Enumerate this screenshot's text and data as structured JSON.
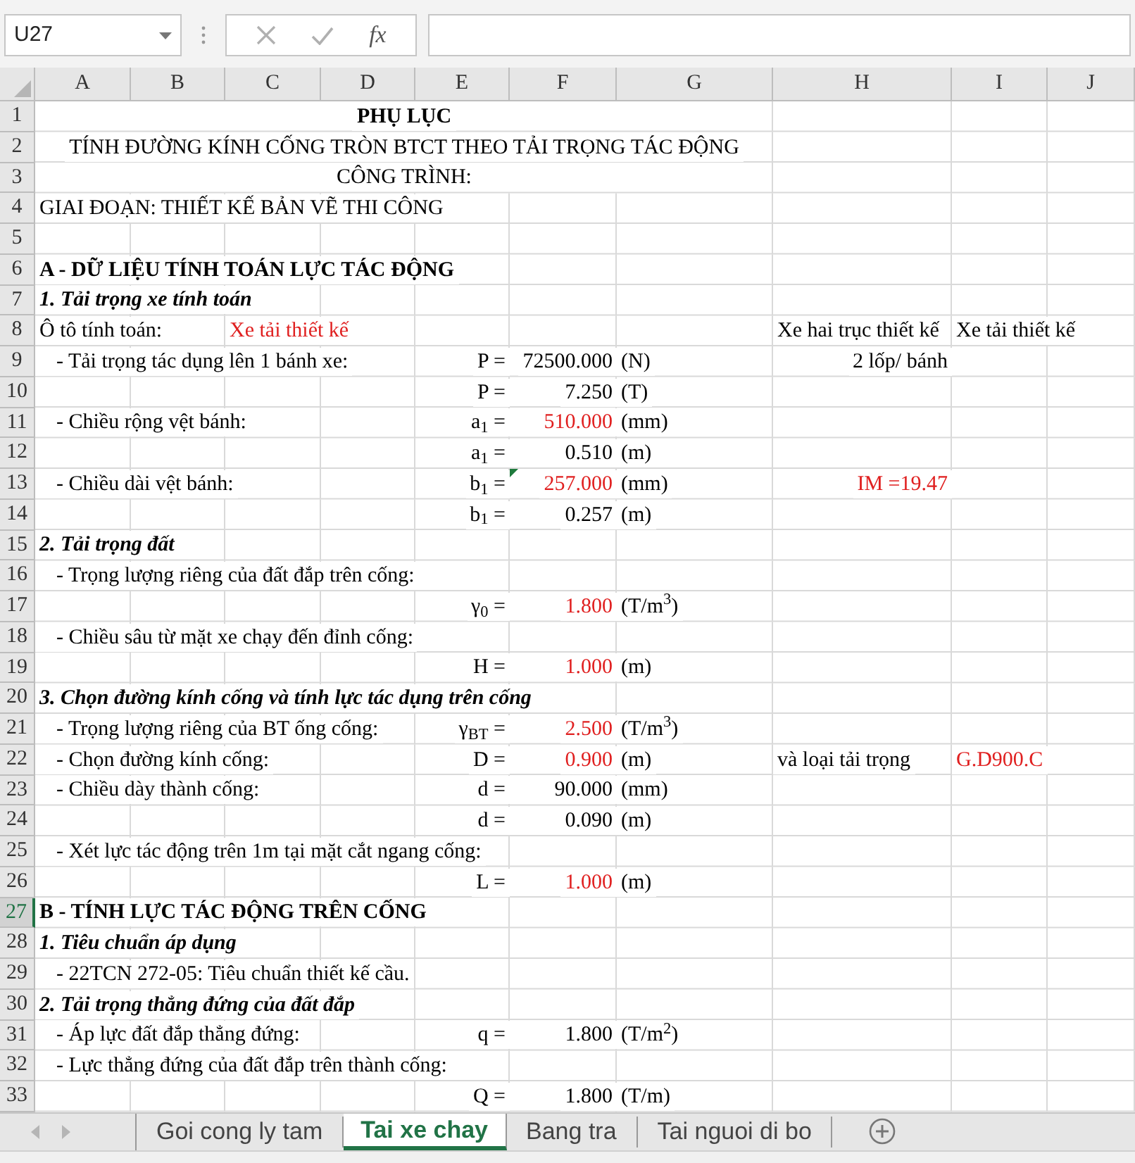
{
  "formula_bar": {
    "name_box": "U27",
    "function_label": "fx"
  },
  "columns": [
    "A",
    "B",
    "C",
    "D",
    "E",
    "F",
    "G",
    "H",
    "I",
    "J"
  ],
  "rows": [
    {
      "number": "1",
      "selected": false,
      "A": {
        "text": "PHỤ LỤC",
        "kind": "title"
      }
    },
    {
      "number": "2",
      "selected": false,
      "A": {
        "text": "TÍNH ĐƯỜNG KÍNH CỐNG TRÒN BTCT THEO TẢI TRỌNG TÁC ĐỘNG",
        "kind": "caption"
      }
    },
    {
      "number": "3",
      "selected": false,
      "A": {
        "text": "CÔNG TRÌNH:",
        "kind": "caption"
      }
    },
    {
      "number": "4",
      "selected": false,
      "A": {
        "text": "GIAI ĐOẠN: THIẾT KẾ BẢN VẼ THI CÔNG"
      }
    },
    {
      "number": "5",
      "selected": false
    },
    {
      "number": "6",
      "selected": false,
      "A": {
        "text": "A - DỮ LIỆU TÍNH TOÁN LỰC TÁC ĐỘNG",
        "kind": "heading"
      }
    },
    {
      "number": "7",
      "selected": false,
      "A": {
        "text": "1. Tải trọng xe tính toán",
        "kind": "subheading"
      }
    },
    {
      "number": "8",
      "selected": false,
      "A": {
        "text": "Ô tô tính toán:"
      },
      "C": {
        "text": "Xe tải thiết kế",
        "color": "#e02020"
      },
      "H": {
        "text": "Xe hai trục thiết kế"
      },
      "I": {
        "text": "Xe tải thiết kế"
      }
    },
    {
      "number": "9",
      "selected": false,
      "A": {
        "text": "- Tải trọng tác dụng lên 1 bánh xe:",
        "kind": "item"
      },
      "E": {
        "text": "P =",
        "kind": "right"
      },
      "F": {
        "text": "72500.000",
        "kind": "right"
      },
      "G": {
        "text": "(N)"
      },
      "H": {
        "text": "2 lốp/ bánh",
        "kind": "right"
      }
    },
    {
      "number": "10",
      "selected": false,
      "E": {
        "text": "P =",
        "kind": "right"
      },
      "F": {
        "text": "7.250",
        "kind": "right"
      },
      "G": {
        "text": "(T)"
      }
    },
    {
      "number": "11",
      "selected": false,
      "A": {
        "text": "- Chiều rộng vệt bánh:",
        "kind": "item"
      },
      "E": {
        "text": "a$_{1}$ =",
        "kind": "right"
      },
      "F": {
        "text": "510.000",
        "kind": "right",
        "color": "#e02020"
      },
      "G": {
        "text": "(mm)"
      }
    },
    {
      "number": "12",
      "selected": false,
      "E": {
        "text": "a$_{1}$ =",
        "kind": "right"
      },
      "F": {
        "text": "0.510",
        "kind": "right"
      },
      "G": {
        "text": "(m)"
      }
    },
    {
      "number": "13",
      "selected": false,
      "A": {
        "text": "- Chiều dài vệt bánh:",
        "kind": "item"
      },
      "E": {
        "text": "b$_{1}$ =",
        "kind": "right"
      },
      "F": {
        "text": "257.000",
        "kind": "right",
        "color": "#e02020",
        "flagged": true
      },
      "G": {
        "text": "(mm)"
      },
      "H": {
        "text": "IM =19.47",
        "kind": "right",
        "color": "#e02020"
      }
    },
    {
      "number": "14",
      "selected": false,
      "E": {
        "text": "b$_{1}$ =",
        "kind": "right"
      },
      "F": {
        "text": "0.257",
        "kind": "right"
      },
      "G": {
        "text": "(m)"
      }
    },
    {
      "number": "15",
      "selected": false,
      "A": {
        "text": "2. Tải trọng đất",
        "kind": "subheading"
      }
    },
    {
      "number": "16",
      "selected": false,
      "A": {
        "text": "- Trọng lượng riêng của đất đắp trên cống:",
        "kind": "item"
      }
    },
    {
      "number": "17",
      "selected": false,
      "E": {
        "text": "γ$_{0}$ =",
        "kind": "right"
      },
      "F": {
        "text": "1.800",
        "kind": "right",
        "color": "#e02020"
      },
      "G": {
        "text": "(T/m$^{3}$)"
      }
    },
    {
      "number": "18",
      "selected": false,
      "A": {
        "text": "- Chiều sâu từ mặt xe chạy đến đỉnh cống:",
        "kind": "item"
      }
    },
    {
      "number": "19",
      "selected": false,
      "E": {
        "text": "H =",
        "kind": "right"
      },
      "F": {
        "text": "1.000",
        "kind": "right",
        "color": "#e02020"
      },
      "G": {
        "text": "(m)"
      }
    },
    {
      "number": "20",
      "selected": false,
      "A": {
        "text": "3. Chọn đường kính cống và tính lực tác dụng trên cống",
        "kind": "subheading"
      }
    },
    {
      "number": "21",
      "selected": false,
      "A": {
        "text": "- Trọng lượng riêng của BT ống cống:",
        "kind": "item"
      },
      "E": {
        "text": "γ$_{BT}$ =",
        "kind": "right"
      },
      "F": {
        "text": "2.500",
        "kind": "right",
        "color": "#e02020"
      },
      "G": {
        "text": "(T/m$^{3}$)"
      }
    },
    {
      "number": "22",
      "selected": false,
      "A": {
        "text": "- Chọn đường kính cống:",
        "kind": "item"
      },
      "E": {
        "text": "D =",
        "kind": "right"
      },
      "F": {
        "text": "0.900",
        "kind": "right",
        "color": "#e02020"
      },
      "G": {
        "text": "(m)"
      },
      "H": {
        "text": "và loại tải trọng"
      },
      "I": {
        "text": "G.D900.C",
        "color": "#e02020"
      }
    },
    {
      "number": "23",
      "selected": false,
      "A": {
        "text": "- Chiều dày thành cống:",
        "kind": "item"
      },
      "E": {
        "text": "d =",
        "kind": "right"
      },
      "F": {
        "text": "90.000",
        "kind": "right"
      },
      "G": {
        "text": "(mm)"
      }
    },
    {
      "number": "24",
      "selected": false,
      "E": {
        "text": "d =",
        "kind": "right"
      },
      "F": {
        "text": "0.090",
        "kind": "right"
      },
      "G": {
        "text": "(m)"
      }
    },
    {
      "number": "25",
      "selected": false,
      "A": {
        "text": "- Xét lực tác động trên 1m tại mặt cắt ngang cống:",
        "kind": "item"
      }
    },
    {
      "number": "26",
      "selected": false,
      "E": {
        "text": "L =",
        "kind": "right"
      },
      "F": {
        "text": "1.000",
        "kind": "right",
        "color": "#e02020"
      },
      "G": {
        "text": "(m)"
      }
    },
    {
      "number": "27",
      "selected": true,
      "A": {
        "text": "B - TÍNH LỰC TÁC ĐỘNG TRÊN CỐNG",
        "kind": "heading"
      }
    },
    {
      "number": "28",
      "selected": false,
      "A": {
        "text": "1. Tiêu chuẩn áp dụng",
        "kind": "subheading"
      }
    },
    {
      "number": "29",
      "selected": false,
      "A": {
        "text": "- 22TCN 272-05: Tiêu chuẩn thiết kế cầu.",
        "kind": "item"
      }
    },
    {
      "number": "30",
      "selected": false,
      "A": {
        "text": "2. Tải trọng thẳng đứng của đất đắp",
        "kind": "subheading"
      }
    },
    {
      "number": "31",
      "selected": false,
      "A": {
        "text": "- Áp lực đất đắp thẳng đứng:",
        "kind": "item"
      },
      "E": {
        "text": "q =",
        "kind": "right"
      },
      "F": {
        "text": "1.800",
        "kind": "right"
      },
      "G": {
        "text": "(T/m$^{2}$)"
      }
    },
    {
      "number": "32",
      "selected": false,
      "A": {
        "text": "- Lực thẳng đứng của đất đắp trên thành cống:",
        "kind": "item"
      }
    },
    {
      "number": "33",
      "selected": false,
      "E": {
        "text": "Q =",
        "kind": "right"
      },
      "F": {
        "text": "1.800",
        "kind": "right"
      },
      "G": {
        "text": "(T/m)"
      }
    }
  ],
  "sheet_tabs": [
    {
      "label": "Goi cong ly tam",
      "selected": false
    },
    {
      "label": "Tai xe chay",
      "selected": true
    },
    {
      "label": "Bang tra",
      "selected": false
    },
    {
      "label": "Tai nguoi di bo",
      "selected": false
    }
  ]
}
